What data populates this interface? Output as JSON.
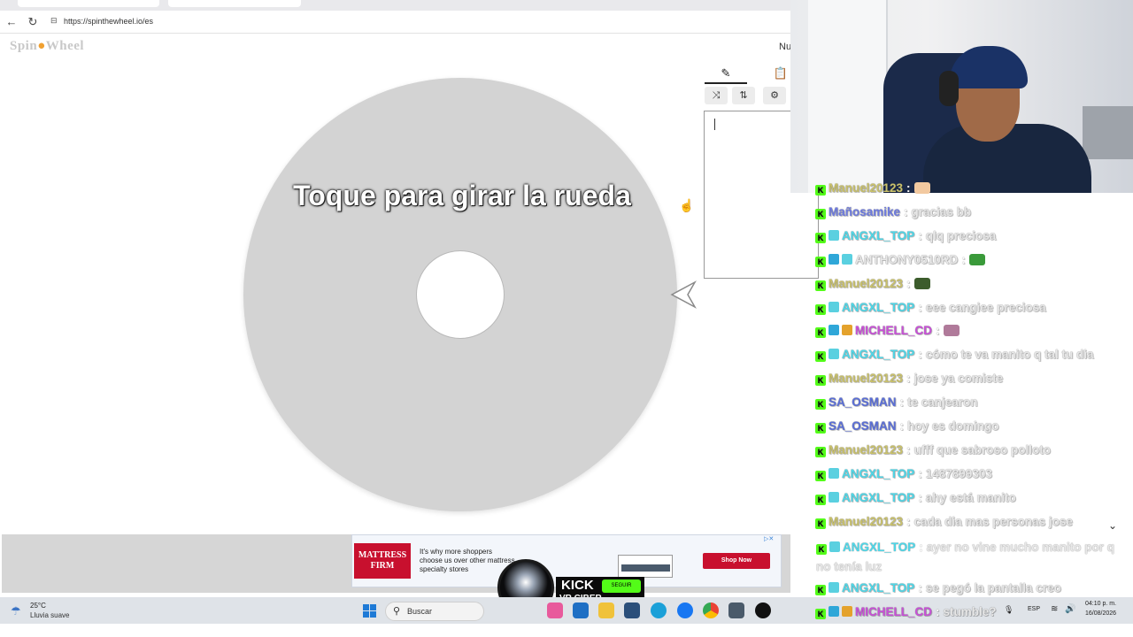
{
  "browser": {
    "url": "https://spinthewheel.io/es"
  },
  "page": {
    "logo_prefix": "Spin",
    "logo_o": "●",
    "logo_suffix": "Wheel",
    "top_right_text": "Nu",
    "wheel_prompt": "Toque para girar la rueda"
  },
  "sidebar": {
    "tab_edit_icon": "✎",
    "tab_results_icon": "📋",
    "tools": [
      "⤨",
      "⇅",
      "⚙"
    ]
  },
  "ad": {
    "brand": "MATTRESS FIRM",
    "copy": "It's why more shoppers choose us over other mattress specialty stores",
    "cta": "Shop Now",
    "flag": "▷✕"
  },
  "overlay": {
    "kick_word": "KICK",
    "kick_sub": "VR CIBER",
    "kick_follow": "SEGUIR"
  },
  "taskbar": {
    "temperature": "25°C",
    "condition": "Lluvia suave",
    "search_placeholder": "Buscar",
    "lang": "ESP",
    "time": "04:10 p. m.",
    "date": "16/08/2026"
  },
  "chat": {
    "messages": [
      {
        "user": "Manuel20123",
        "color": "#c9c16a",
        "badges": [
          "k"
        ],
        "text": "",
        "emote": "#f2c9a0"
      },
      {
        "user": "Mañosamike",
        "color": "#6e7be0",
        "badges": [
          "k"
        ],
        "text": "gracias bb"
      },
      {
        "user": "ANGXL_TOP",
        "color": "#4fd7e8",
        "badges": [
          "k",
          "sub"
        ],
        "text": "qlq preciosa"
      },
      {
        "user": "ANTHONY0510RD",
        "color": "#e8e8e8",
        "badges": [
          "k",
          "blue",
          "sub"
        ],
        "text": "",
        "emote": "#3a9a3a"
      },
      {
        "user": "Manuel20123",
        "color": "#c9c16a",
        "badges": [
          "k"
        ],
        "text": "",
        "emote": "#3c5c2c"
      },
      {
        "user": "ANGXL_TOP",
        "color": "#4fd7e8",
        "badges": [
          "k",
          "sub"
        ],
        "text": "eee cangiee preciosa"
      },
      {
        "user": "MICHELL_CD",
        "color": "#c94fd8",
        "badges": [
          "k",
          "blue",
          "gold"
        ],
        "text": "",
        "emote": "#b07a9a"
      },
      {
        "user": "ANGXL_TOP",
        "color": "#4fd7e8",
        "badges": [
          "k",
          "sub"
        ],
        "text": "cómo te va manito q tal tu dia"
      },
      {
        "user": "Manuel20123",
        "color": "#c9c16a",
        "badges": [
          "k"
        ],
        "text": "jose ya comiste"
      },
      {
        "user": "SA_OSMAN",
        "color": "#5b6fd8",
        "badges": [
          "k"
        ],
        "text": "te canjearon"
      },
      {
        "user": "SA_OSMAN",
        "color": "#5b6fd8",
        "badges": [
          "k"
        ],
        "text": "hoy es domingo"
      },
      {
        "user": "Manuel20123",
        "color": "#c9c16a",
        "badges": [
          "k"
        ],
        "text": "ufff que sabroso polloto"
      },
      {
        "user": "ANGXL_TOP",
        "color": "#4fd7e8",
        "badges": [
          "k",
          "sub"
        ],
        "text": "1487899303"
      },
      {
        "user": "ANGXL_TOP",
        "color": "#4fd7e8",
        "badges": [
          "k",
          "sub"
        ],
        "text": "ahy está manito"
      },
      {
        "user": "Manuel20123",
        "color": "#c9c16a",
        "badges": [
          "k"
        ],
        "text": "cada dia mas personas jose"
      }
    ],
    "wrapped": {
      "user": "ANGXL_TOP",
      "text_line1": "ayer no vine mucho manito por q",
      "text_line2": "no tenía luz"
    },
    "tail": [
      {
        "user": "ANGXL_TOP",
        "color": "#4fd7e8",
        "badges": [
          "k",
          "sub"
        ],
        "text": "se pegó la pantalla creo"
      },
      {
        "user": "MICHELL_CD",
        "color": "#c94fd8",
        "badges": [
          "k",
          "blue",
          "gold"
        ],
        "text": "stumble?"
      }
    ],
    "separator": ":"
  },
  "colors": {
    "kick_green": "#53fc18",
    "wheel_grey": "#d3d3d3",
    "ad_red": "#c8102e"
  }
}
